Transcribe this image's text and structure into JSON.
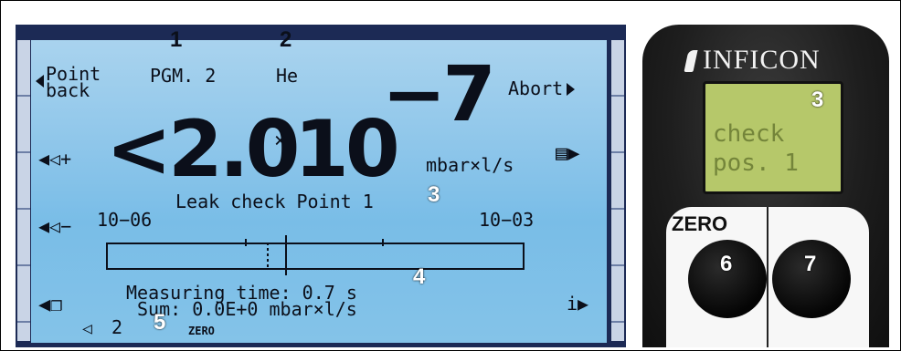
{
  "lcd": {
    "left_top": [
      "Point",
      "back"
    ],
    "program": "PGM. 2",
    "gas": "He",
    "abort": "Abort",
    "value_prefix": "<2.0",
    "value_times": "×",
    "value_base": "10",
    "value_exp": "−7",
    "unit": "mbar×l/s",
    "point_label": "Leak check Point 1",
    "scale_min": "10−06",
    "scale_max": "10−03",
    "measuring_time": "Measuring time: 0.7 s",
    "sum": "Sum: 0.0E+0 mbar×l/s",
    "volume_level": "2",
    "zero_status": "ZERO",
    "info": "i",
    "icons": [
      "volume-up-icon",
      "volume-down-icon",
      "menu-icon",
      "windows-icon",
      "speaker-icon"
    ]
  },
  "annotations": [
    "1",
    "2",
    "3",
    "4",
    "5",
    "3",
    "6",
    "7"
  ],
  "device": {
    "brand": "INFICON",
    "screen_lines": [
      "check",
      "pos. 1"
    ],
    "zero_label": "ZERO"
  }
}
